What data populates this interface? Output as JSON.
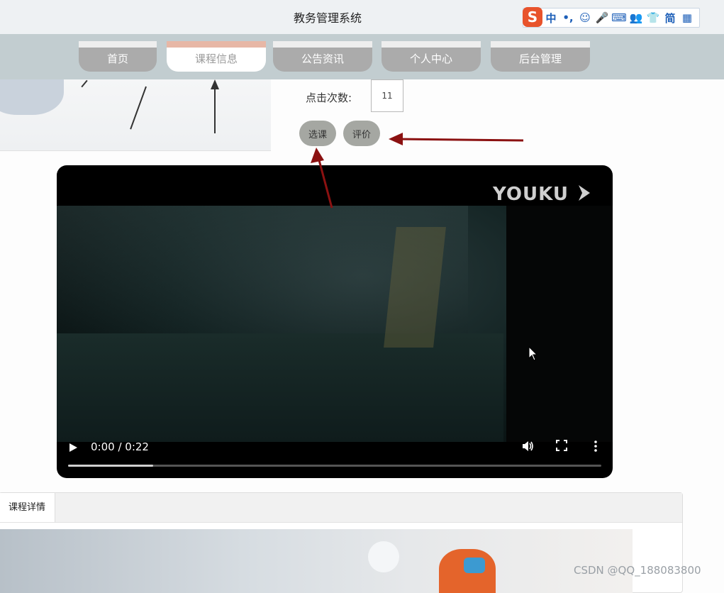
{
  "app": {
    "title": "教务管理系统"
  },
  "ime": {
    "logo": "S",
    "items": [
      "中",
      "•,",
      "☺",
      "🎤",
      "⌨",
      "👥",
      "👕",
      "简",
      "▦"
    ]
  },
  "nav": {
    "tabs": [
      {
        "label": "首页",
        "active": false
      },
      {
        "label": "课程信息",
        "active": true
      },
      {
        "label": "公告资讯",
        "active": false
      },
      {
        "label": "个人中心",
        "active": false
      },
      {
        "label": "后台管理",
        "active": false
      }
    ]
  },
  "course": {
    "click_count_label": "点击次数:",
    "click_count_value": "11",
    "select_button": "选课",
    "review_button": "评价"
  },
  "video": {
    "logo": "YOUKU",
    "time": "0:00 / 0:22",
    "progress": 0.16
  },
  "details": {
    "tab_label": "课程详情"
  },
  "watermark": "CSDN @QQ_188083800",
  "colors": {
    "annotation_arrow": "#8b1111",
    "nav_bar": "#c2cdd0",
    "active_tab_top": "#e7b7a6"
  }
}
